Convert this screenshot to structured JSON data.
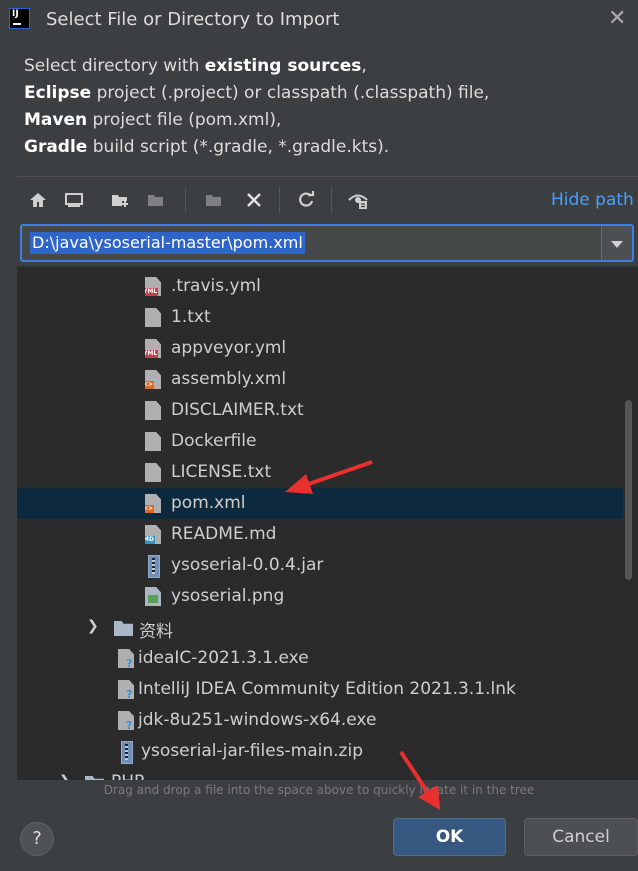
{
  "window": {
    "title": "Select File or Directory to Import",
    "icon_text": "IJ"
  },
  "description": {
    "line1": {
      "prefix": "Select directory with ",
      "bold": "existing sources",
      "suffix": ","
    },
    "line2": {
      "bold": "Eclipse",
      "suffix": " project (.project) or classpath (.classpath) file,"
    },
    "line3": {
      "bold": "Maven",
      "suffix": " project file (pom.xml),"
    },
    "line4": {
      "bold": "Gradle",
      "suffix": " build script (*.gradle, *.gradle.kts)."
    }
  },
  "toolbar": {
    "icons": [
      "home-icon",
      "desktop-icon",
      "new-folder-icon",
      "project-folder-icon",
      "module-folder-icon",
      "delete-icon",
      "refresh-icon",
      "show-hidden-icon"
    ],
    "hide_path_label": "Hide path"
  },
  "path": {
    "value": "D:\\java\\ysoserial-master\\pom.xml"
  },
  "tree": {
    "items": [
      {
        "label": ".travis.yml",
        "icon": "yml-file-icon"
      },
      {
        "label": "1.txt",
        "icon": "text-file-icon"
      },
      {
        "label": "appveyor.yml",
        "icon": "yml-file-icon"
      },
      {
        "label": "assembly.xml",
        "icon": "xml-file-icon"
      },
      {
        "label": "DISCLAIMER.txt",
        "icon": "text-file-icon"
      },
      {
        "label": "Dockerfile",
        "icon": "text-file-icon"
      },
      {
        "label": "LICENSE.txt",
        "icon": "text-file-icon"
      },
      {
        "label": "pom.xml",
        "icon": "xml-file-icon",
        "selected": true
      },
      {
        "label": "README.md",
        "icon": "markdown-file-icon"
      },
      {
        "label": "ysoserial-0.0.4.jar",
        "icon": "archive-file-icon"
      },
      {
        "label": "ysoserial.png",
        "icon": "image-file-icon"
      },
      {
        "label": "资料",
        "icon": "folder-icon"
      },
      {
        "label": "ideaIC-2021.3.1.exe",
        "icon": "unknown-file-icon"
      },
      {
        "label": "IntelliJ IDEA Community Edition 2021.3.1.lnk",
        "icon": "unknown-file-icon"
      },
      {
        "label": "jdk-8u251-windows-x64.exe",
        "icon": "unknown-file-icon"
      },
      {
        "label": "ysoserial-jar-files-main.zip",
        "icon": "archive-file-icon"
      },
      {
        "label": "PHP",
        "icon": "folder-icon"
      }
    ]
  },
  "hint": "Drag and drop a file into the space above to quickly locate it in the tree",
  "buttons": {
    "help": "?",
    "ok": "OK",
    "cancel": "Cancel"
  },
  "colors": {
    "accent": "#3d7ee8",
    "selection": "#0d293e",
    "annotation": "#e8312f",
    "link": "#4a9dff"
  }
}
